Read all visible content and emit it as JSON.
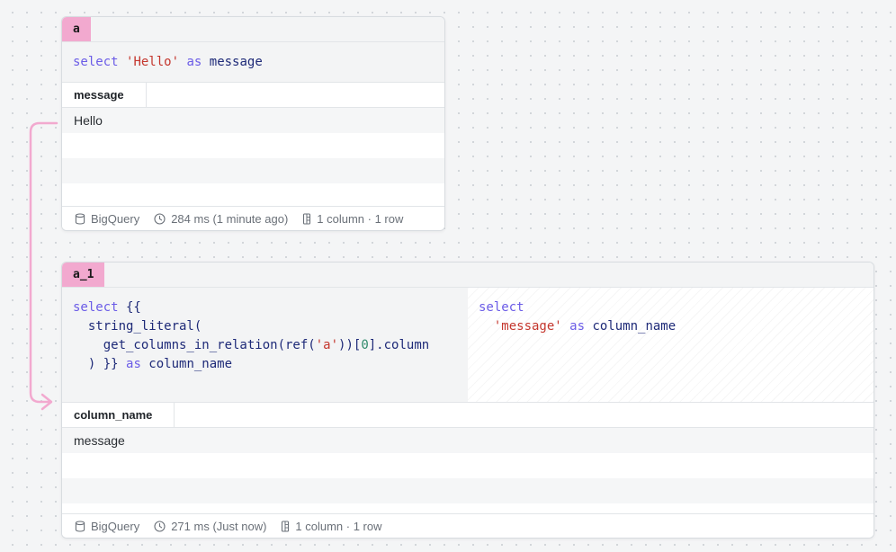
{
  "cells": {
    "a": {
      "name": "a",
      "code": {
        "kw_select": "select",
        "literal": "'Hello'",
        "kw_as": "as",
        "alias": "message"
      },
      "columns": [
        "message"
      ],
      "rows": [
        "Hello"
      ],
      "footer": {
        "engine": "BigQuery",
        "timing": "284 ms (1 minute ago)",
        "shape": "1 column · 1 row"
      }
    },
    "a_1": {
      "name": "a_1",
      "code": {
        "line1_kw": "select",
        "line1_rest": " {{",
        "line2": "  string_literal(",
        "line3_a": "    get_columns_in_relation(ref(",
        "line3_str": "'a'",
        "line3_b": "))[",
        "line3_num": "0",
        "line3_c": "].column",
        "line4_a": "  ) }} ",
        "line4_kw": "as",
        "line4_b": " column_name"
      },
      "compiled": {
        "kw_select": "select",
        "literal": "'message'",
        "kw_as": "as",
        "alias": "column_name"
      },
      "columns": [
        "column_name"
      ],
      "rows": [
        "message"
      ],
      "footer": {
        "engine": "BigQuery",
        "timing": "271 ms (Just now)",
        "shape": "1 column · 1 row"
      }
    }
  },
  "icons": {
    "engine": "database-icon",
    "timing": "clock-icon",
    "shape": "table-columns-icon"
  },
  "colors": {
    "tag": "#f2a9cf",
    "link": "#f2a9cf",
    "keyword": "#6b5ce7",
    "string": "#c4362d"
  }
}
